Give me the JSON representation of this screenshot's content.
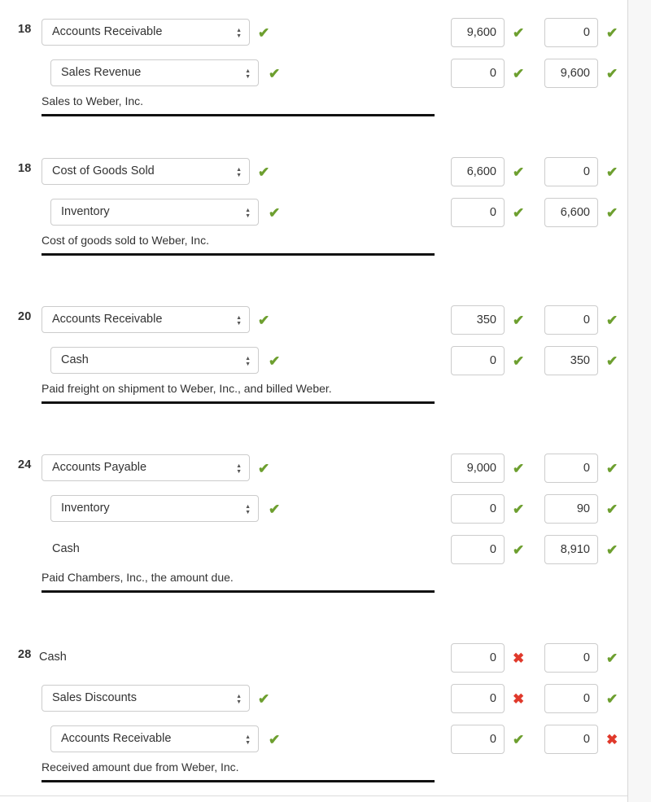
{
  "icons": {
    "correct": "✔",
    "incorrect": "✖",
    "select_up": "▲",
    "select_down": "▼"
  },
  "colors": {
    "correct": "#6d9f2f",
    "incorrect": "#e0392b",
    "input_border": "#cccccc",
    "rule": "#111111",
    "text": "#333333",
    "gutter": "#f7f7f7"
  },
  "journal": {
    "entries": [
      {
        "date": "18",
        "lines": [
          {
            "indent": 1,
            "control": "select",
            "account": "Accounts Receivable",
            "account_status": "correct",
            "debit": "9,600",
            "debit_status": "correct",
            "credit": "0",
            "credit_status": "correct"
          },
          {
            "indent": 2,
            "control": "select",
            "account": "Sales Revenue",
            "account_status": "correct",
            "debit": "0",
            "debit_status": "correct",
            "credit": "9,600",
            "credit_status": "correct"
          }
        ],
        "memo": "Sales to Weber, Inc."
      },
      {
        "date": "18",
        "lines": [
          {
            "indent": 1,
            "control": "select",
            "account": "Cost of Goods Sold",
            "account_status": "correct",
            "debit": "6,600",
            "debit_status": "correct",
            "credit": "0",
            "credit_status": "correct"
          },
          {
            "indent": 2,
            "control": "select",
            "account": "Inventory",
            "account_status": "correct",
            "debit": "0",
            "debit_status": "correct",
            "credit": "6,600",
            "credit_status": "correct"
          }
        ],
        "memo": "Cost of goods sold to Weber, Inc."
      },
      {
        "date": "20",
        "lines": [
          {
            "indent": 1,
            "control": "select",
            "account": "Accounts Receivable",
            "account_status": "correct",
            "debit": "350",
            "debit_status": "correct",
            "credit": "0",
            "credit_status": "correct"
          },
          {
            "indent": 2,
            "control": "select",
            "account": "Cash",
            "account_status": "correct",
            "debit": "0",
            "debit_status": "correct",
            "credit": "350",
            "credit_status": "correct"
          }
        ],
        "memo": "Paid freight on shipment to Weber, Inc., and billed Weber."
      },
      {
        "date": "24",
        "lines": [
          {
            "indent": 1,
            "control": "select",
            "account": "Accounts Payable",
            "account_status": "correct",
            "debit": "9,000",
            "debit_status": "correct",
            "credit": "0",
            "credit_status": "correct"
          },
          {
            "indent": 2,
            "control": "select",
            "account": "Inventory",
            "account_status": "correct",
            "debit": "0",
            "debit_status": "correct",
            "credit": "90",
            "credit_status": "correct"
          },
          {
            "indent": 3,
            "control": "text",
            "account": "Cash",
            "account_status": "none",
            "debit": "0",
            "debit_status": "correct",
            "credit": "8,910",
            "credit_status": "correct"
          }
        ],
        "memo": "Paid Chambers, Inc., the amount due."
      },
      {
        "date": "28",
        "lines": [
          {
            "indent": 0,
            "control": "text",
            "account": "Cash",
            "account_status": "none",
            "debit": "0",
            "debit_status": "incorrect",
            "credit": "0",
            "credit_status": "correct"
          },
          {
            "indent": 1,
            "control": "select",
            "account": "Sales Discounts",
            "account_status": "correct",
            "debit": "0",
            "debit_status": "incorrect",
            "credit": "0",
            "credit_status": "correct"
          },
          {
            "indent": 2,
            "control": "select",
            "account": "Accounts Receivable",
            "account_status": "correct",
            "debit": "0",
            "debit_status": "correct",
            "credit": "0",
            "credit_status": "incorrect"
          }
        ],
        "memo": "Received amount due from Weber, Inc."
      }
    ]
  }
}
